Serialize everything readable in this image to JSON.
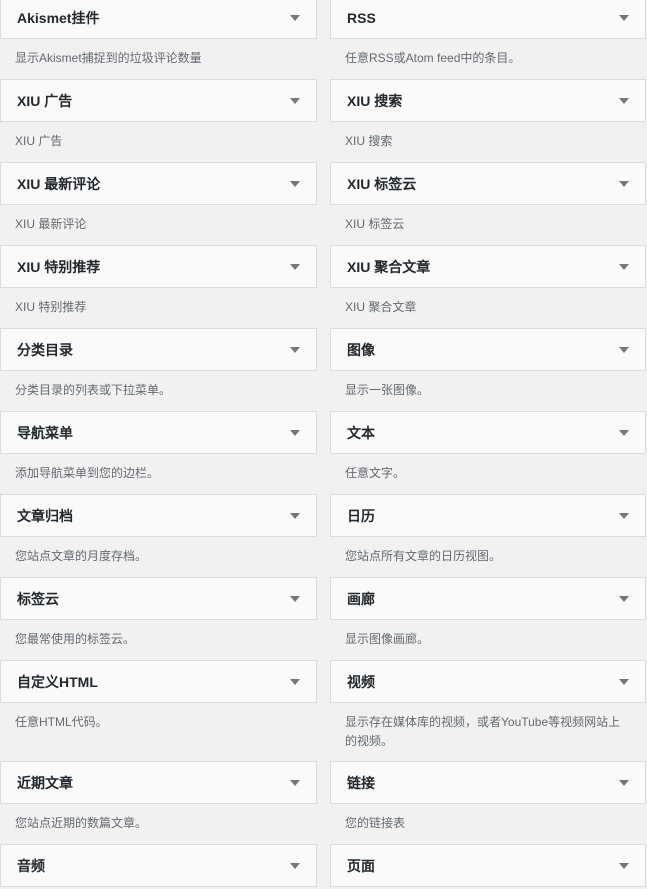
{
  "widgets": [
    {
      "title": "Akismet挂件",
      "desc": "显示Akismet捕捉到的垃圾评论数量"
    },
    {
      "title": "RSS",
      "desc": "任意RSS或Atom feed中的条目。"
    },
    {
      "title": "XIU 广告",
      "desc": "XIU 广告"
    },
    {
      "title": "XIU 搜索",
      "desc": "XIU 搜索"
    },
    {
      "title": "XIU 最新评论",
      "desc": "XIU 最新评论"
    },
    {
      "title": "XIU 标签云",
      "desc": "XIU 标签云"
    },
    {
      "title": "XIU 特别推荐",
      "desc": "XIU 特别推荐"
    },
    {
      "title": "XIU 聚合文章",
      "desc": "XIU 聚合文章"
    },
    {
      "title": "分类目录",
      "desc": "分类目录的列表或下拉菜单。"
    },
    {
      "title": "图像",
      "desc": "显示一张图像。"
    },
    {
      "title": "导航菜单",
      "desc": "添加导航菜单到您的边栏。"
    },
    {
      "title": "文本",
      "desc": "任意文字。"
    },
    {
      "title": "文章归档",
      "desc": "您站点文章的月度存档。"
    },
    {
      "title": "日历",
      "desc": "您站点所有文章的日历视图。"
    },
    {
      "title": "标签云",
      "desc": "您最常使用的标签云。"
    },
    {
      "title": "画廊",
      "desc": "显示图像画廊。"
    },
    {
      "title": "自定义HTML",
      "desc": "任意HTML代码。"
    },
    {
      "title": "视频",
      "desc": "显示存在媒体库的视频，或者YouTube等视频网站上的视频。"
    },
    {
      "title": "近期文章",
      "desc": "您站点近期的数篇文章。"
    },
    {
      "title": "链接",
      "desc": "您的链接表"
    },
    {
      "title": "音频",
      "desc": ""
    },
    {
      "title": "页面",
      "desc": ""
    }
  ],
  "icons": {
    "toggle": "chevron-down-icon"
  },
  "colors": {
    "background": "#f1f1f1",
    "card": "#fafafa",
    "border": "#dcdcde",
    "title": "#23282d",
    "desc": "#646970"
  }
}
